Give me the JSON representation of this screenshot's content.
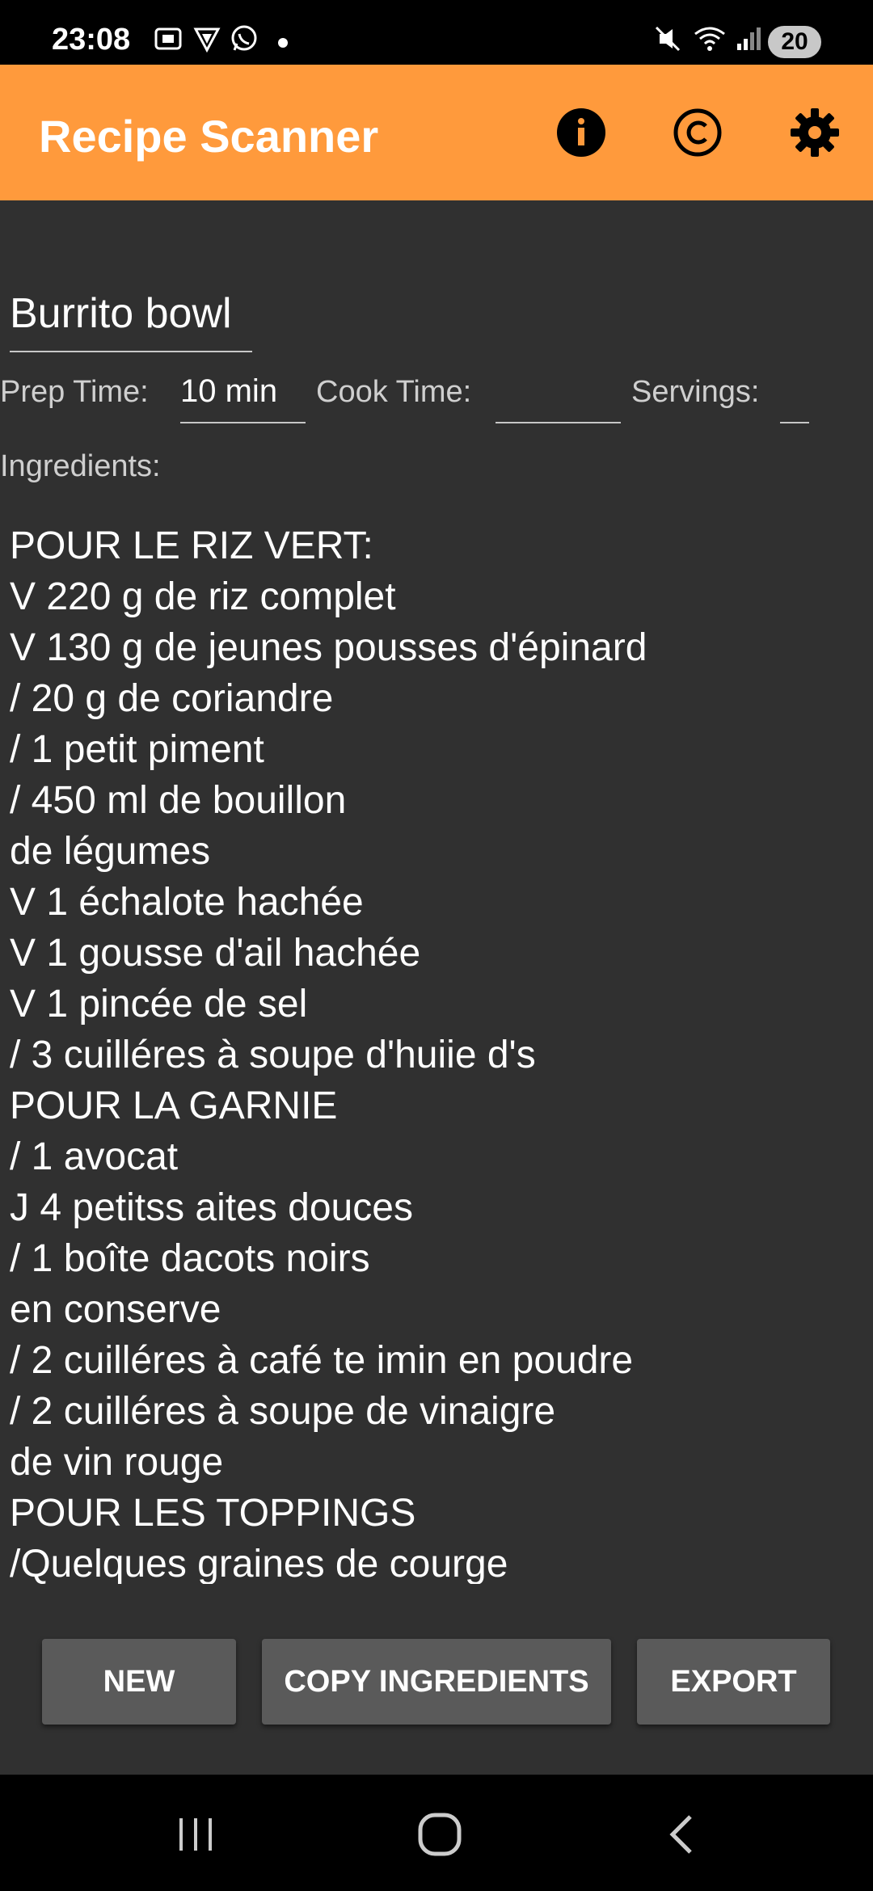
{
  "status_bar": {
    "time": "23:08",
    "battery": "20",
    "icons": [
      "screenshot-icon",
      "vpn-icon",
      "whatsapp-icon",
      "dot-icon",
      "mute-icon",
      "wifi-icon",
      "signal-icon"
    ]
  },
  "app_bar": {
    "title": "Recipe Scanner",
    "actions": [
      "info-icon",
      "copyright-icon",
      "settings-icon"
    ],
    "color": "#ff9a3c"
  },
  "recipe": {
    "title": "Burrito bowl",
    "prep_label": "Prep Time:",
    "prep_value": "10 min",
    "cook_label": "Cook Time:",
    "cook_value": "",
    "servings_label": "Servings:",
    "servings_value": "",
    "ingredients_label": "Ingredients:",
    "ingredients": [
      "POUR LE RIZ VERT:",
      "V 220 g de riz complet",
      "V 130 g de jeunes pousses d'épinard",
      "/ 20 g de coriandre",
      "/ 1 petit piment",
      "/ 450 ml de bouillon",
      "de légumes",
      "V 1 échalote hachée",
      "V 1 gousse d'ail hachée",
      "V 1 pincée de sel",
      "/ 3 cuilléres à soupe d'huiie d's",
      "POUR LA GARNIE",
      "/ 1 avocat",
      "J 4 petitss aites douces",
      "/ 1 boîte dacots noirs",
      "en conserve",
      "/ 2 cuilléres à café te imin en poudre",
      "/ 2 cuilléres à soupe de vinaigre",
      "de vin rouge",
      "POUR LES TOPPINGS",
      "/Quelques graines de courge"
    ]
  },
  "buttons": {
    "new": "NEW",
    "copy": "COPY INGREDIENTS",
    "export": "EXPORT"
  },
  "nav_bar": {
    "buttons": [
      "recents-icon",
      "home-icon",
      "back-icon"
    ]
  }
}
